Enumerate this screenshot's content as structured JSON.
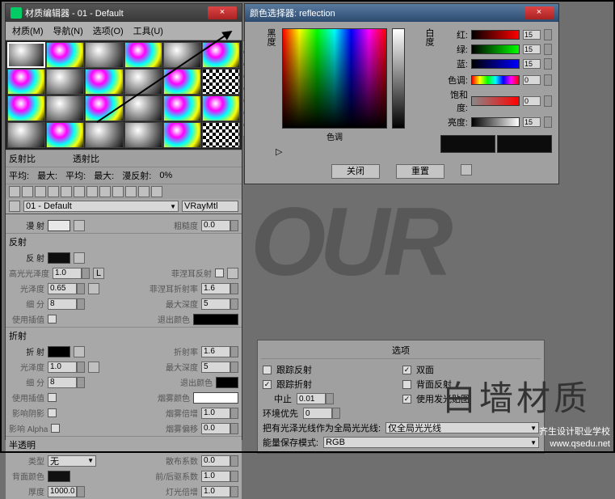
{
  "material_editor": {
    "title": "材质编辑器 - 01 - Default",
    "menu": [
      "材质(M)",
      "导航(N)",
      "选项(O)",
      "工具(U)"
    ],
    "toolbar": {
      "refl_label": "反射比",
      "trans_label": "透射比",
      "avg": "平均:",
      "max": "最大:",
      "avg2": "平均:",
      "max2": "最大:",
      "diff": "漫反射:",
      "zero": "0%"
    },
    "name_row": {
      "current": "01 - Default",
      "type": "VRayMtl"
    },
    "diffuse": {
      "label": "漫 射",
      "rough_label": "粗糙度",
      "rough": "0.0"
    },
    "reflection": {
      "header": "反射",
      "refl_label": "反 射",
      "gloss_label": "高光光泽度",
      "gloss": "1.0",
      "lock": "L",
      "rgloss_label": "光泽度",
      "rgloss": "0.65",
      "subdiv_label": "细  分",
      "subdiv": "8",
      "interp_label": "使用插值",
      "fresnel_label": "菲涅耳反射",
      "fresnel_ior_label": "菲涅耳折射率",
      "fresnel_ior": "1.6",
      "maxdepth_label": "最大深度",
      "maxdepth": "5",
      "exit_label": "退出颜色"
    },
    "refraction": {
      "header": "折射",
      "refr_label": "折 射",
      "ior_label": "折射率",
      "ior": "1.6",
      "gloss_label": "光泽度",
      "gloss": "1.0",
      "maxdepth_label": "最大深度",
      "maxdepth": "5",
      "subdiv_label": "细  分",
      "subdiv": "8",
      "exit_label": "退出颜色",
      "interp_label": "使用插值",
      "fog_label": "烟雾颜色",
      "shadow_label": "影响阴影",
      "fogmult_label": "烟雾倍增",
      "fogmult": "1.0",
      "alpha_label": "影响 Alpha",
      "fogbias_label": "烟雾偏移",
      "fogbias": "0.0"
    },
    "translucency": {
      "header": "半透明",
      "type_label": "类型",
      "type_value": "无",
      "scatter_label": "散布系数",
      "scatter": "0.0",
      "back_label": "背面颜色",
      "fwd_label": "前/后驱系数",
      "fwd": "1.0",
      "thick_label": "厚度",
      "thick": "1000.0",
      "light_label": "灯光倍增",
      "light": "1.0"
    }
  },
  "color_picker": {
    "title": "颜色选择器: reflection",
    "black_label": "黑度",
    "hue_label": "色调",
    "white_label": "白度",
    "r": "红:",
    "g": "绿:",
    "b": "蓝:",
    "h": "色调:",
    "s": "饱和度:",
    "v": "亮度:",
    "rv": "15",
    "gv": "15",
    "bv": "15",
    "hv": "0",
    "sv": "0",
    "vv": "15",
    "close": "关闭",
    "reset": "重置"
  },
  "options": {
    "title": "选项",
    "trace_refl": "跟踪反射",
    "double": "双面",
    "trace_refr": "跟踪折射",
    "back_refl": "背面反射",
    "cutoff_label": "中止",
    "cutoff": "0.01",
    "emit": "使用发光贴图",
    "env_label": "环境优先",
    "env": "0",
    "gloss_ray_label": "把有光泽光线作为全局光光线:",
    "gloss_ray": "仅全局光光线",
    "energy_label": "能量保存模式:",
    "energy": "RGB"
  },
  "annotation": "白墙材质",
  "credit_cn": "齐生设计职业学校",
  "credit_url": "www.qsedu.net"
}
